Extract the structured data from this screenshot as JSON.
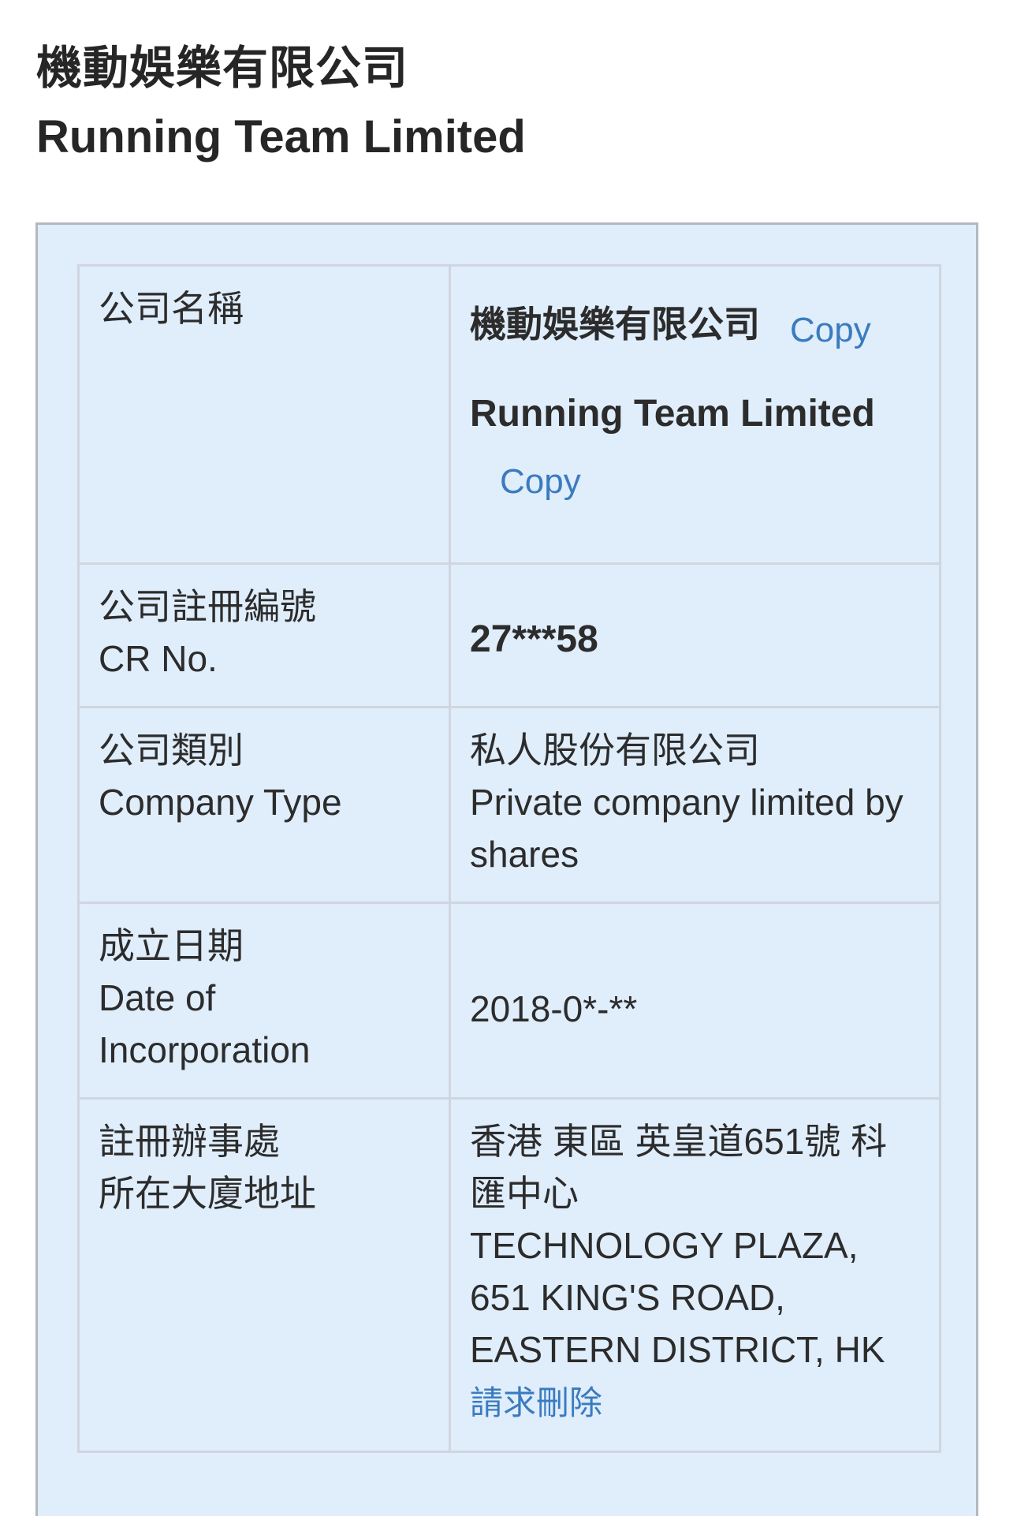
{
  "header": {
    "title_zh": "機動娛樂有限公司",
    "title_en": "Running Team Limited"
  },
  "table": {
    "company_name": {
      "label": "公司名稱",
      "value_zh": "機動娛樂有限公司",
      "value_en": "Running Team Limited",
      "copy_label": "Copy"
    },
    "cr_no": {
      "label_zh": "公司註冊編號",
      "label_en": "CR No.",
      "value": "27***58"
    },
    "company_type": {
      "label_zh": "公司類別",
      "label_en": "Company Type",
      "value_zh": "私人股份有限公司",
      "value_en": "Private company limited by shares"
    },
    "incorporation_date": {
      "label_zh": "成立日期",
      "label_en": "Date of Incorporation",
      "value": "2018-0*-**"
    },
    "registered_address": {
      "label_line1": "註冊辦事處",
      "label_line2": "所在大廈地址",
      "value_zh": "香港 東區 英皇道651號 科匯中心",
      "value_en": "TECHNOLOGY PLAZA, 651 KING'S ROAD, EASTERN DISTRICT, HK",
      "request_delete_label": "請求刪除"
    }
  },
  "colors": {
    "panel_background": "#e0edfb",
    "link": "#3a7bbf",
    "text": "#2c2c2c",
    "border": "#cfd6df"
  }
}
